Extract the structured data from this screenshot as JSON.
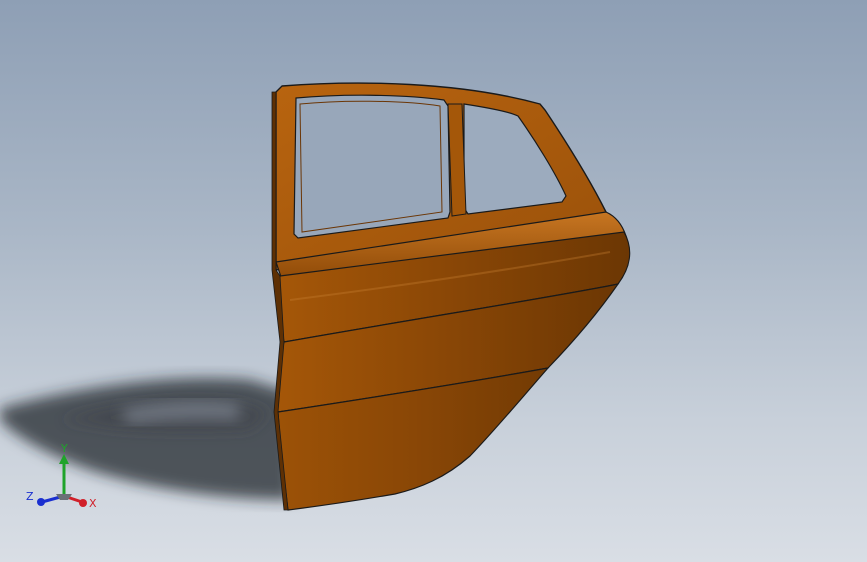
{
  "viewport": {
    "background_top": "#8e9fb5",
    "background_bottom": "#d9dee5"
  },
  "model": {
    "part_color": "#a85a0a",
    "part_shade": "#7a3f05",
    "part_highlight": "#c4731a",
    "edge_color": "#1a1a1a"
  },
  "triad": {
    "x_label": "X",
    "y_label": "Y",
    "z_label": "Z",
    "x_color": "#d0202a",
    "y_color": "#1fa32a",
    "z_color": "#1a2fd0"
  }
}
